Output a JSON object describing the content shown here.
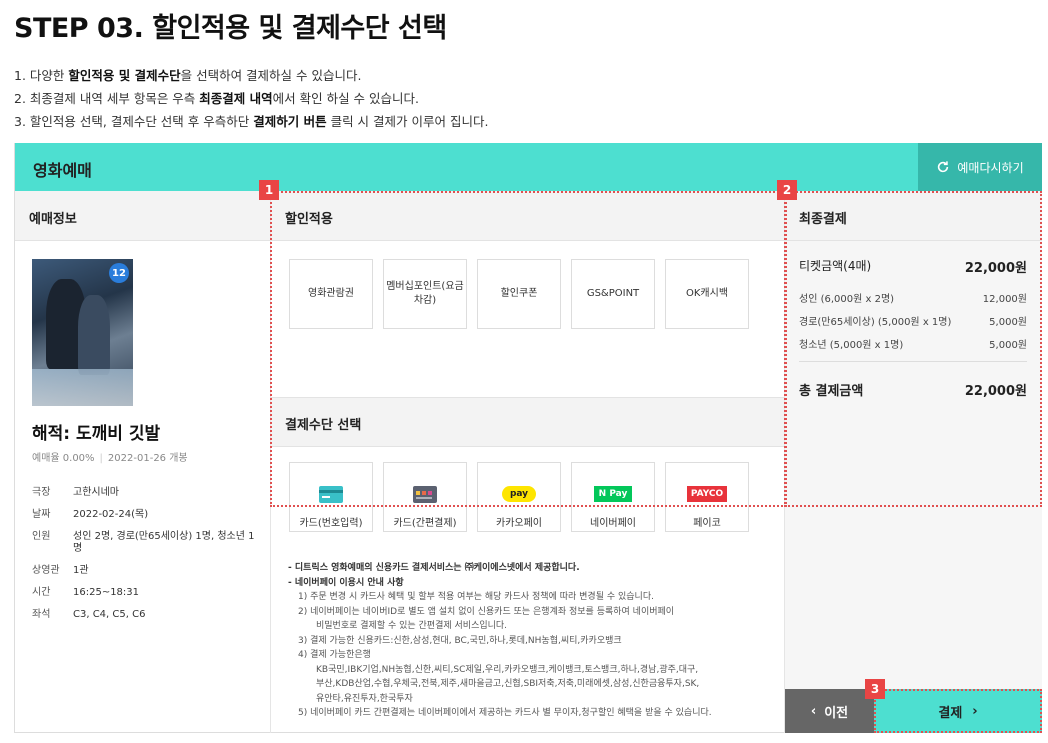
{
  "step": {
    "title": "STEP 03. 할인적용 및 결제수단 선택"
  },
  "instructions": [
    {
      "num": "1. ",
      "pre": "다양한 ",
      "bold": "할인적용 및 결제수단",
      "post": "을 선택하여 결제하실 수 있습니다."
    },
    {
      "num": "2. ",
      "pre": "최종결제 내역 세부 항목은 우측 ",
      "bold": "최종결제 내역",
      "post": "에서 확인 하실 수 있습니다."
    },
    {
      "num": "3. ",
      "pre": "할인적용 선택, 결제수단 선택 후 우측하단 ",
      "bold": "결제하기 버튼",
      "post": " 클릭 시 결제가 이루어 집니다."
    }
  ],
  "header": {
    "title": "영화예매",
    "rebook_label": "예매다시하기"
  },
  "booking_info": {
    "section_title": "예매정보",
    "age_rating": "12",
    "movie_title": "해적: 도깨비 깃발",
    "booking_rate": "예매율 0.00%",
    "release": "2022-01-26 개봉",
    "rows": [
      {
        "k": "극장",
        "v": "고한시네마"
      },
      {
        "k": "날짜",
        "v": "2022-02-24(목)"
      },
      {
        "k": "인원",
        "v": "성인 2명, 경로(만65세이상) 1명, 청소년 1명"
      },
      {
        "k": "상영관",
        "v": "1관"
      },
      {
        "k": "시간",
        "v": "16:25~18:31"
      },
      {
        "k": "좌석",
        "v": "C3, C4, C5, C6"
      }
    ]
  },
  "discount": {
    "section_title": "할인적용",
    "options": [
      "영화관람권",
      "멤버십포인트(요금차감)",
      "할인쿠폰",
      "GS&POINT",
      "OK캐시백"
    ]
  },
  "payment": {
    "section_title": "결제수단 선택",
    "methods": [
      {
        "label": "카드(번호입력)",
        "icon": "card-icon"
      },
      {
        "label": "카드(간편결제)",
        "icon": "card-easy-icon"
      },
      {
        "label": "카카오페이",
        "icon": "kakaopay-icon",
        "icon_text": "pay"
      },
      {
        "label": "네이버페이",
        "icon": "naverpay-icon",
        "icon_text": "N Pay"
      },
      {
        "label": "페이코",
        "icon": "payco-icon",
        "icon_text": "PAYCO"
      }
    ],
    "colors": {
      "card": "#39c0c8",
      "kakao": "#fee500",
      "naver": "#03c75a",
      "payco": "#e8333b"
    }
  },
  "notice": {
    "line1": "- 디트릭스 영화예매의 신용카드 결제서비스는 ㈜케이에스넷에서 제공합니다.",
    "line2": "- 네이버페이 이용시 안내 사항",
    "items": [
      "1) 주문 변경 시 카드사 혜택 및 할부 적용 여부는 해당 카드사 정책에 따라 변경될 수 있습니다.",
      "2) 네이버페이는 네이버ID로 별도 앱 설치 없이 신용카드 또는 은행계좌 정보를 등록하여 네이버페이",
      "비밀번호로 결제할 수 있는 간편결제 서비스입니다.",
      "3) 결제 가능한 신용카드:신한,삼성,현대, BC,국민,하나,롯데,NH농협,씨티,카카오뱅크",
      "4) 결제 가능한은행",
      "KB국민,IBK기업,NH농협,신한,씨티,SC제일,우리,카카오뱅크,케이뱅크,토스뱅크,하나,경남,광주,대구,",
      "부산,KDB산업,수협,우체국,전북,제주,새마을금고,신협,SBI저축,저축,미래에셋,삼성,신한금융투자,SK,",
      "유안타,유진투자,한국투자",
      "5) 네이버페이 카드 간편결제는 네이버페이에서 제공하는 카드사 별 무이자,청구할인 혜택을 받을 수 있습니다."
    ]
  },
  "summary": {
    "section_title": "최종결제",
    "ticket_label": "티켓금액(4매)",
    "ticket_value": "22,000원",
    "lines": [
      {
        "k": "성인 (6,000원 x 2명)",
        "v": "12,000원"
      },
      {
        "k": "경로(만65세이상) (5,000원 x 1명)",
        "v": "5,000원"
      },
      {
        "k": "청소년 (5,000원 x 1명)",
        "v": "5,000원"
      }
    ],
    "total_label": "총 결제금액",
    "total_value": "22,000원"
  },
  "buttons": {
    "prev_label": "이전",
    "pay_label": "결제"
  },
  "markers": [
    "1",
    "2",
    "3"
  ]
}
